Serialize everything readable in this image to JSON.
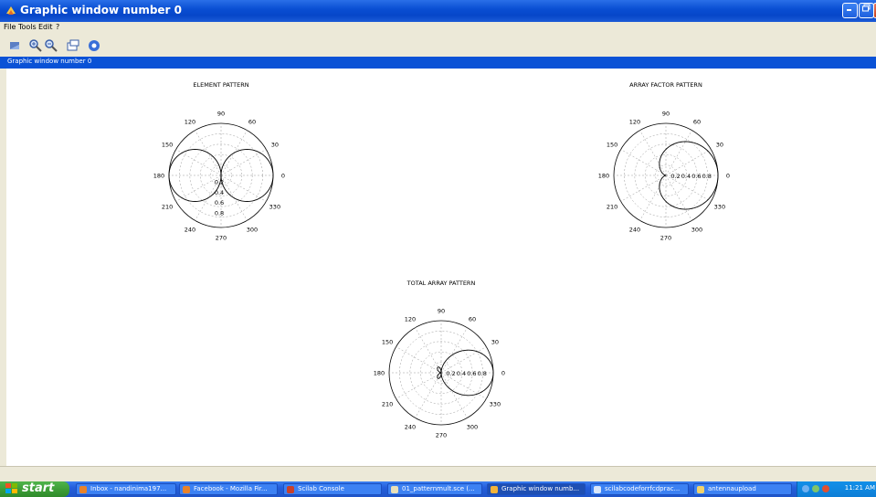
{
  "window": {
    "title": "Graphic window number 0"
  },
  "menu": [
    "File",
    "Tools",
    "Edit",
    "?"
  ],
  "toolbar": [
    "rotate-icon",
    "zoom-in-icon",
    "zoom-out-icon",
    "window-icon",
    "help-icon"
  ],
  "infobar": {
    "text": "Graphic window number 0"
  },
  "plots": [
    {
      "id": "element",
      "title": "ELEMENT PATTERN",
      "radial_labels": [
        "0.2",
        "0.4",
        "0.6",
        "0.8"
      ],
      "radial_labels_orientation": "vertical"
    },
    {
      "id": "array",
      "title": "ARRAY FACTOR PATTERN",
      "radial_labels": [
        "0.2",
        "0.4",
        "0.6",
        "0.8"
      ],
      "radial_labels_orientation": "horizontal"
    },
    {
      "id": "total",
      "title": "TOTAL ARRAY PATTERN",
      "radial_labels": [
        "0.2",
        "0.4",
        "0.6",
        "0.8"
      ],
      "radial_labels_orientation": "horizontal"
    }
  ],
  "angle_labels": [
    "0",
    "30",
    "60",
    "90",
    "120",
    "150",
    "180",
    "210",
    "240",
    "270",
    "300",
    "330"
  ],
  "chart_data": [
    {
      "type": "polar",
      "title": "ELEMENT PATTERN",
      "pattern": "|cos(theta)|",
      "rlim": [
        0,
        1
      ],
      "angle_ticks_deg": [
        0,
        30,
        60,
        90,
        120,
        150,
        180,
        210,
        240,
        270,
        300,
        330
      ],
      "r_ticks": [
        0.2,
        0.4,
        0.6,
        0.8
      ]
    },
    {
      "type": "polar",
      "title": "ARRAY FACTOR PATTERN",
      "pattern": "(1+cos(theta))/2",
      "rlim": [
        0,
        1
      ],
      "angle_ticks_deg": [
        0,
        30,
        60,
        90,
        120,
        150,
        180,
        210,
        240,
        270,
        300,
        330
      ],
      "r_ticks": [
        0.2,
        0.4,
        0.6,
        0.8
      ]
    },
    {
      "type": "polar",
      "title": "TOTAL ARRAY PATTERN",
      "pattern": "|cos(theta)|*(1+cos(theta))/2",
      "rlim": [
        0,
        1
      ],
      "angle_ticks_deg": [
        0,
        30,
        60,
        90,
        120,
        150,
        180,
        210,
        240,
        270,
        300,
        330
      ],
      "r_ticks": [
        0.2,
        0.4,
        0.6,
        0.8
      ]
    }
  ],
  "taskbar": {
    "start": "start",
    "buttons": [
      "Inbox - nandinima197...",
      "Facebook - Mozilla Fir...",
      "Scilab Console",
      "01_patternmult.sce (...",
      "Graphic window numb...",
      "scilabcodeforrfcdprac...",
      "antennaupload"
    ],
    "active_index": 4,
    "clock": "11:21 AM"
  },
  "colors": {
    "title_blue": "#0a4fd3",
    "info_blue": "#0a52d6",
    "taskbar_blue": "#245edb",
    "start_green": "#3a9a35"
  }
}
